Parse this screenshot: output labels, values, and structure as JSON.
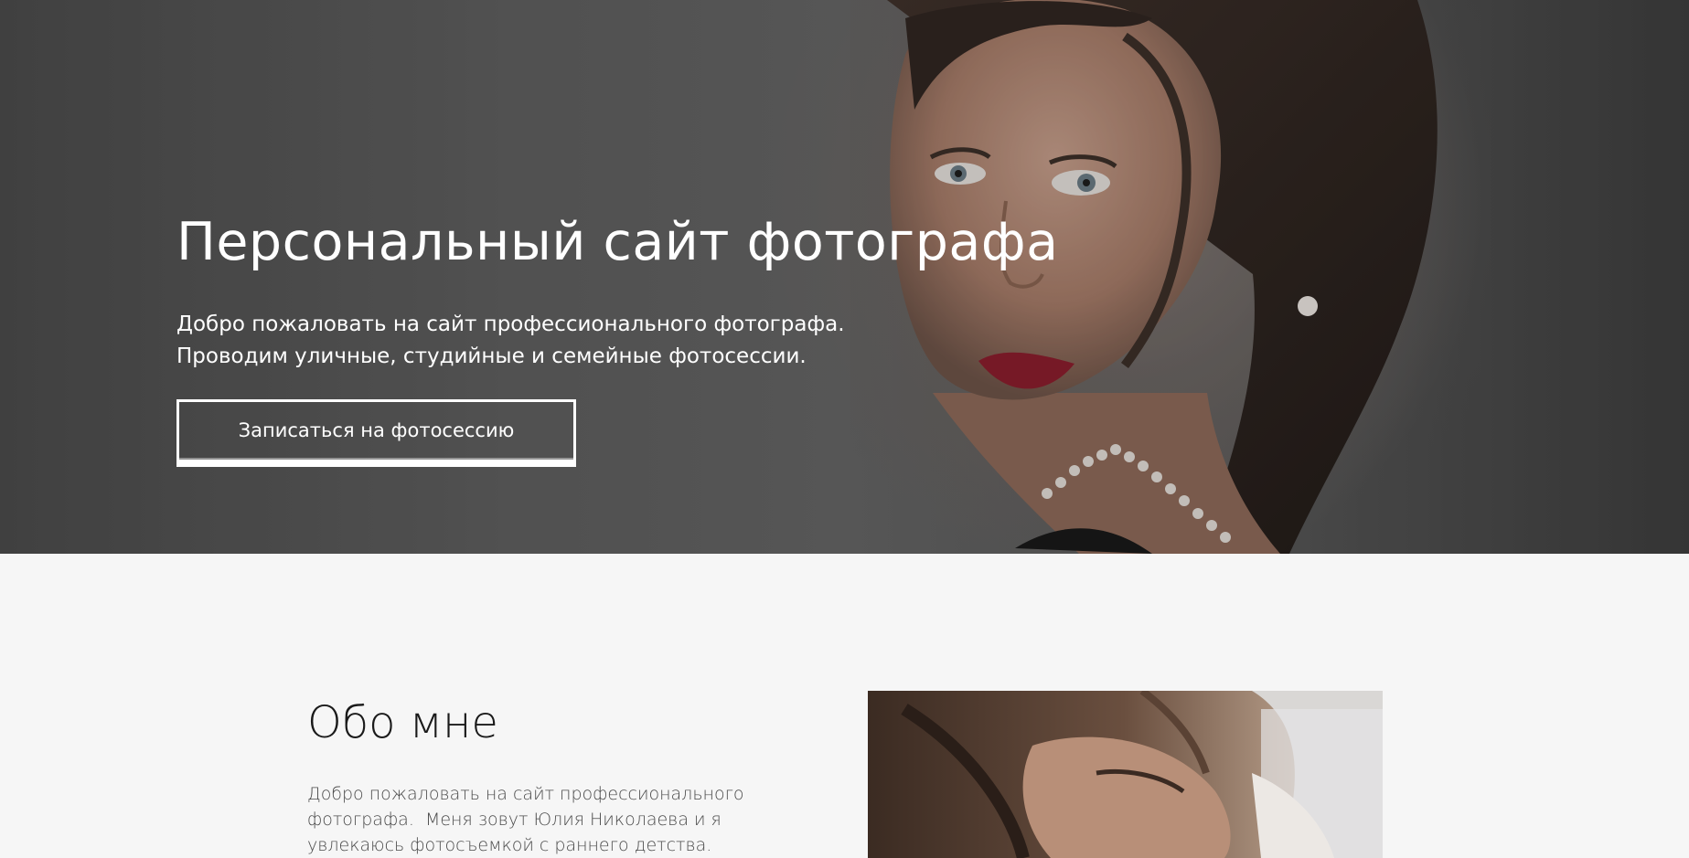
{
  "hero": {
    "title": "Персональный сайт фотографа",
    "subtitle_line1": "Добро пожаловать на сайт профессионального фотографа.",
    "subtitle_line2": "Проводим уличные, студийные и семейные фотосессии.",
    "cta_label": "Записаться на фотосессию",
    "photo_icon": "portrait-photo"
  },
  "about": {
    "title": "Обо мне",
    "text_line1": "Добро пожаловать на сайт профессионального",
    "text_line2": "фотографа.  Меня зовут Юлия Николаева и я",
    "text_line3": "увлекаюсь фотосъемкой с раннего детства.",
    "photo_icon": "photographer-photo"
  },
  "colors": {
    "hero_bg": "#5a5a5a",
    "text_light": "#ffffff",
    "page_bg": "#f6f6f6",
    "lip_red": "#8c1a2a"
  }
}
